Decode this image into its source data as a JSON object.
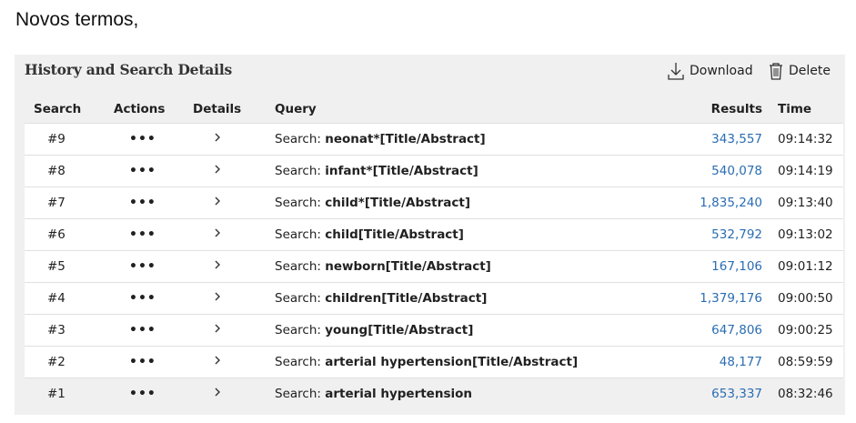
{
  "intro_text": "Novos termos,",
  "panel": {
    "title": "History and Search Details",
    "download_label": "Download",
    "delete_label": "Delete"
  },
  "columns": {
    "search": "Search",
    "actions": "Actions",
    "details": "Details",
    "query": "Query",
    "results": "Results",
    "time": "Time"
  },
  "actions_glyph": "•••",
  "details_glyph": "›",
  "query_prefix": "Search:",
  "rows": [
    {
      "search": "#9",
      "term": "neonat*[Title/Abstract]",
      "results": "343,557",
      "time": "09:14:32"
    },
    {
      "search": "#8",
      "term": "infant*[Title/Abstract]",
      "results": "540,078",
      "time": "09:14:19"
    },
    {
      "search": "#7",
      "term": "child*[Title/Abstract]",
      "results": "1,835,240",
      "time": "09:13:40"
    },
    {
      "search": "#6",
      "term": "child[Title/Abstract]",
      "results": "532,792",
      "time": "09:13:02"
    },
    {
      "search": "#5",
      "term": "newborn[Title/Abstract]",
      "results": "167,106",
      "time": "09:01:12"
    },
    {
      "search": "#4",
      "term": "children[Title/Abstract]",
      "results": "1,379,176",
      "time": "09:00:50"
    },
    {
      "search": "#3",
      "term": "young[Title/Abstract]",
      "results": "647,806",
      "time": "09:00:25"
    },
    {
      "search": "#2",
      "term": "arterial hypertension[Title/Abstract]",
      "results": "48,177",
      "time": "08:59:59"
    },
    {
      "search": "#1",
      "term": "arterial hypertension",
      "results": "653,337",
      "time": "08:32:46"
    }
  ],
  "colors": {
    "results_link": "#2a6db3",
    "panel_bg": "#f0f0f0"
  },
  "icons": {
    "download": "download-icon",
    "delete": "trash-icon"
  }
}
